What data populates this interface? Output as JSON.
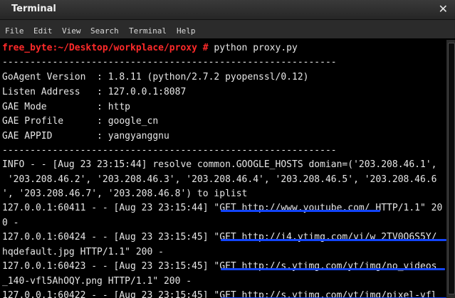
{
  "window": {
    "title": "Terminal"
  },
  "menu": [
    "File",
    "Edit",
    "View",
    "Search",
    "Terminal",
    "Help"
  ],
  "prompt": {
    "user_path": "free_byte:~/Desktop/workplace/proxy #",
    "command": " python proxy.py"
  },
  "separator": "------------------------------------------------------------",
  "config": [
    "GoAgent Version  : 1.8.11 (python/2.7.2 pyopenssl/0.12)",
    "Listen Address   : 127.0.0.1:8087",
    "GAE Mode         : http",
    "GAE Profile      : google_cn",
    "GAE APPID        : yangyanggnu"
  ],
  "log": [
    "INFO - - [Aug 23 23:15:44] resolve common.GOOGLE_HOSTS domian=('203.208.46.1',",
    " '203.208.46.2', '203.208.46.3', '203.208.46.4', '203.208.46.5', '203.208.46.6",
    "', '203.208.46.7', '203.208.46.8') to iplist",
    "127.0.0.1:60411 - - [Aug 23 23:15:44] \"GET http://www.youtube.com/ HTTP/1.1\" 20",
    "0 -",
    "127.0.0.1:60424 - - [Aug 23 23:15:45] \"GET http://i4.ytimg.com/vi/w 2TV0Q6S5Y/",
    "hqdefault.jpg HTTP/1.1\" 200 -",
    "127.0.0.1:60423 - - [Aug 23 23:15:45] \"GET http://s.ytimg.com/yt/img/no_videos",
    "_140-vfl5AhOQY.png HTTP/1.1\" 200 -",
    "127.0.0.1:60422 - - [Aug 23 23:15:45] \"GET http://s.ytimg.com/yt/img/pixel-vfl"
  ]
}
